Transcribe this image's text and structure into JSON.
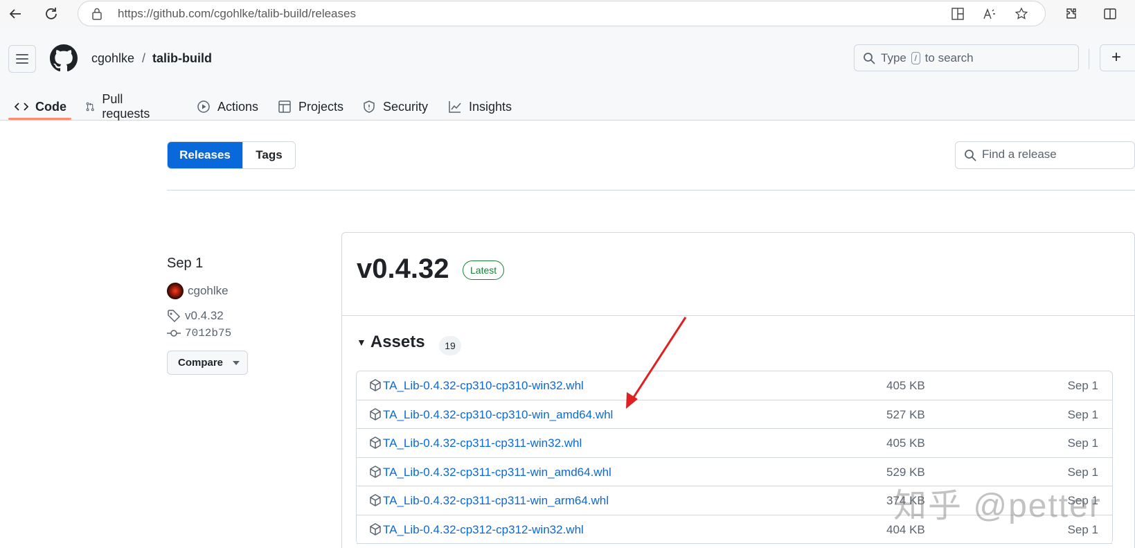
{
  "browser": {
    "url": "https://github.com/cgohlke/talib-build/releases"
  },
  "header": {
    "owner": "cgohlke",
    "separator": "/",
    "repo": "talib-build",
    "search_prefix": "Type",
    "search_key": "/",
    "search_suffix": "to search"
  },
  "tabs": [
    {
      "label": "Code",
      "icon": "code-icon",
      "selected": true
    },
    {
      "label": "Pull requests",
      "icon": "pull-request-icon"
    },
    {
      "label": "Actions",
      "icon": "play-icon"
    },
    {
      "label": "Projects",
      "icon": "table-icon"
    },
    {
      "label": "Security",
      "icon": "shield-icon"
    },
    {
      "label": "Insights",
      "icon": "graph-icon"
    }
  ],
  "release_nav": {
    "releases_label": "Releases",
    "tags_label": "Tags",
    "find_placeholder": "Find a release"
  },
  "release": {
    "date": "Sep 1",
    "author": "cgohlke",
    "tag": "v0.4.32",
    "commit": "7012b75",
    "compare_label": "Compare",
    "version": "v0.4.32",
    "badge": "Latest",
    "assets_title": "Assets",
    "assets_count": "19",
    "assets": [
      {
        "name": "TA_Lib-0.4.32-cp310-cp310-win32.whl",
        "size": "405 KB",
        "date": "Sep 1"
      },
      {
        "name": "TA_Lib-0.4.32-cp310-cp310-win_amd64.whl",
        "size": "527 KB",
        "date": "Sep 1"
      },
      {
        "name": "TA_Lib-0.4.32-cp311-cp311-win32.whl",
        "size": "405 KB",
        "date": "Sep 1"
      },
      {
        "name": "TA_Lib-0.4.32-cp311-cp311-win_amd64.whl",
        "size": "529 KB",
        "date": "Sep 1"
      },
      {
        "name": "TA_Lib-0.4.32-cp311-cp311-win_arm64.whl",
        "size": "374 KB",
        "date": "Sep 1"
      },
      {
        "name": "TA_Lib-0.4.32-cp312-cp312-win32.whl",
        "size": "404 KB",
        "date": "Sep 1"
      }
    ]
  },
  "watermark": "知乎 @petter",
  "colors": {
    "accent": "#0969da",
    "latest": "#1a7f37",
    "tab_underline": "#fd8c73",
    "annotation_arrow": "#e02020"
  }
}
